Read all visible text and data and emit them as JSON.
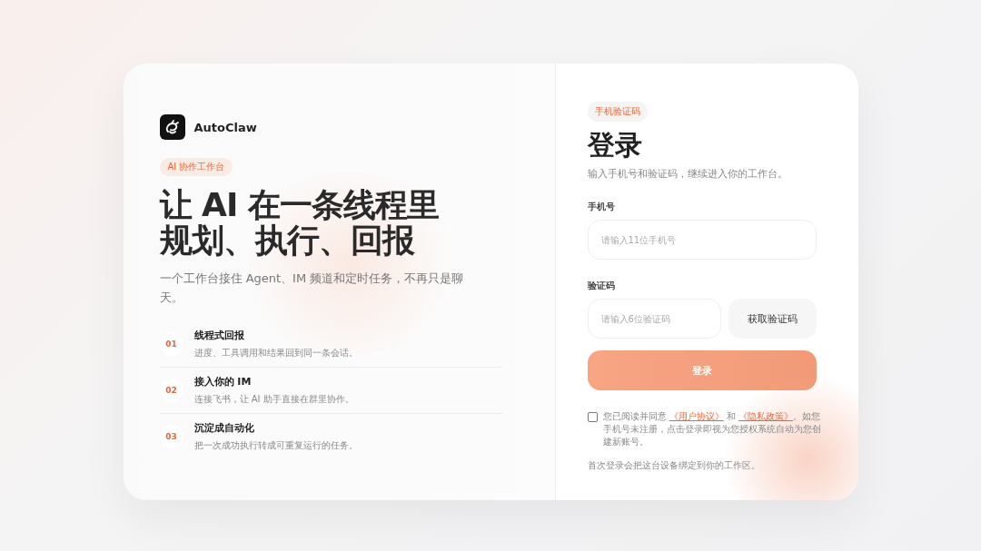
{
  "brand": {
    "name": "AutoClaw"
  },
  "left": {
    "badge": "AI 协作工作台",
    "headline_lines": [
      "让 AI 在一条线程里",
      "规划、执行、回报"
    ],
    "subtitle": "一个工作台接住 Agent、IM 频道和定时任务，不再只是聊天。",
    "features": [
      {
        "number": "01",
        "title": "线程式回报",
        "desc": "进度、工具调用和结果回到同一条会话。"
      },
      {
        "number": "02",
        "title": "接入你的 IM",
        "desc": "连接飞书，让 AI 助手直接在群里协作。"
      },
      {
        "number": "03",
        "title": "沉淀成自动化",
        "desc": "把一次成功执行转成可重复运行的任务。"
      }
    ]
  },
  "login": {
    "badge": "手机验证码",
    "title": "登录",
    "subtitle": "输入手机号和验证码，继续进入你的工作台。",
    "phone": {
      "label": "手机号",
      "placeholder": "请输入11位手机号"
    },
    "code": {
      "label": "验证码",
      "placeholder": "请输入6位验证码",
      "button": "获取验证码"
    },
    "submit": "登录",
    "agreement": {
      "checked": false,
      "before": "您已阅读并同意",
      "link1": "《用户协议》",
      "middle": "和",
      "link2": "《隐私政策》",
      "after": "。如您手机号未注册，点击登录即视为您授权系统自动为您创建新账号。"
    },
    "footnote": "首次登录会把这台设备绑定到你的工作区。"
  }
}
